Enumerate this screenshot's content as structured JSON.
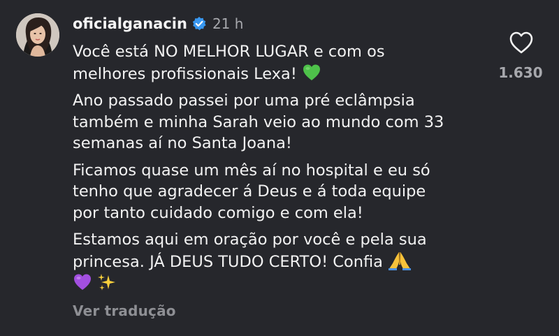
{
  "comment": {
    "username": "oficialganacin",
    "time": "21 h",
    "paragraphs": [
      [
        "Você está NO MELHOR LUGAR e com os",
        "melhores profissionais Lexa!"
      ],
      [
        "Ano passado passei por uma pré eclâmpsia",
        "também e minha Sarah veio ao mundo com 33",
        "semanas aí no Santa Joana!"
      ],
      [
        "Ficamos quase um mês aí no hospital e eu só",
        "tenho que agradecer á Deus e á toda equipe",
        "por tanto cuidado comigo e com ela!"
      ],
      [
        "Estamos aqui em oração por você e pela sua",
        "princesa. JÁ DEUS TUDO CERTO! Confia"
      ]
    ],
    "translate_label": "Ver tradução",
    "like_count": "1.630"
  },
  "icons": {
    "verified": "verified-badge-icon",
    "like": "heart-outline-icon",
    "green_heart": "green-heart-emoji",
    "folded_hands": "folded-hands-emoji",
    "purple_heart": "purple-heart-emoji",
    "sparkles": "sparkles-emoji"
  },
  "colors": {
    "background": "#26272c",
    "verified": "#3897f0",
    "muted_text": "#a7a8ad"
  }
}
